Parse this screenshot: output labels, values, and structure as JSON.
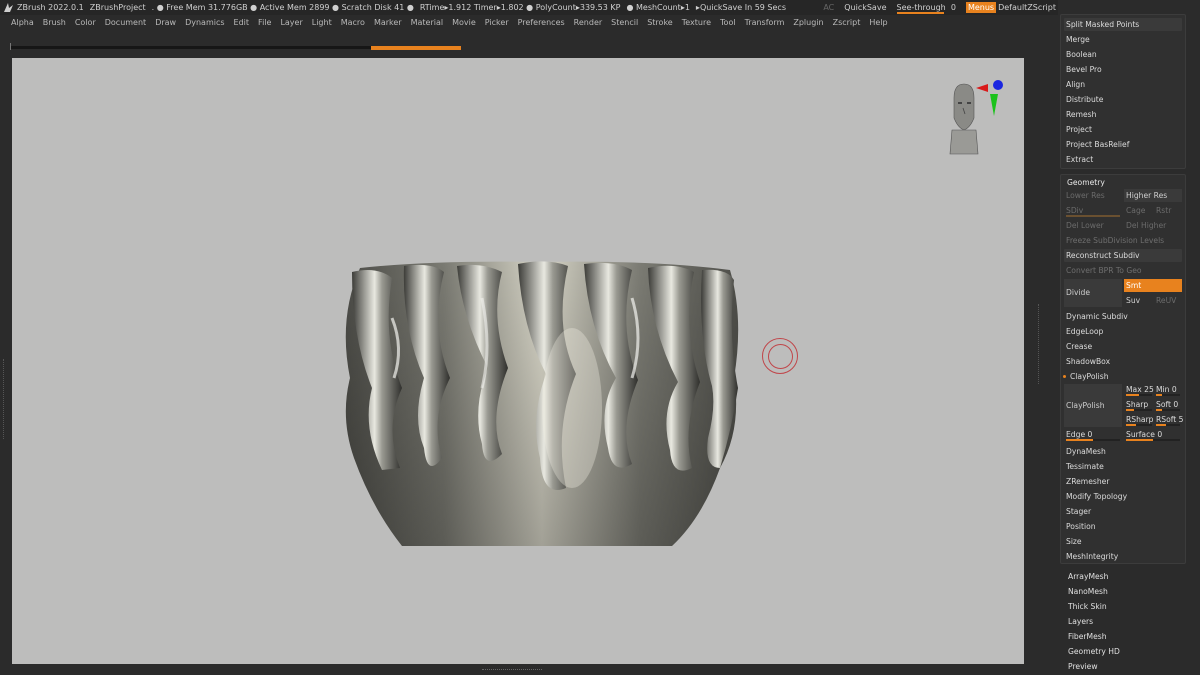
{
  "titlebar": {
    "segments": [
      "ZBrush 2022.0.1",
      "ZBrushProject",
      ". ● Free Mem 31.776GB ● Active Mem 2899 ● Scratch Disk 41 ●",
      "RTime▸1.912 Timer▸1.802 ● PolyCount▸339.53 KP",
      "● MeshCount▸1",
      "▸QuickSave In 59 Secs"
    ],
    "ac": "AC",
    "quicksave": "QuickSave",
    "see_through_label": "See-through",
    "see_through_value": "0",
    "menus": "Menus",
    "default_zscript": "DefaultZScript"
  },
  "menubar": [
    "Alpha",
    "Brush",
    "Color",
    "Document",
    "Draw",
    "Dynamics",
    "Edit",
    "File",
    "Layer",
    "Light",
    "Macro",
    "Marker",
    "Material",
    "Movie",
    "Picker",
    "Preferences",
    "Render",
    "Stencil",
    "Stroke",
    "Texture",
    "Tool",
    "Transform",
    "Zplugin",
    "Zscript",
    "Help"
  ],
  "top_group": [
    "Split Masked Points",
    "Merge",
    "Boolean",
    "Bevel Pro",
    "Align",
    "Distribute",
    "Remesh",
    "Project",
    "Project BasRelief",
    "Extract"
  ],
  "geometry": {
    "header": "Geometry",
    "lower_res": "Lower Res",
    "higher_res": "Higher Res",
    "sdiv": "SDiv",
    "cage": "Cage",
    "rstr": "Rstr",
    "del_lower": "Del Lower",
    "del_higher": "Del Higher",
    "freeze": "Freeze SubDivision Levels",
    "reconstruct": "Reconstruct Subdiv",
    "convert": "Convert BPR To Geo",
    "divide": "Divide",
    "smt": "Smt",
    "suv": "Suv",
    "reuv": "ReUV",
    "dynamic_subdiv": "Dynamic Subdiv",
    "edgeloop": "EdgeLoop",
    "crease": "Crease",
    "shadowbox": "ShadowBox",
    "claypolish_header": "ClayPolish",
    "claypolish_btn": "ClayPolish",
    "max": "Max 25",
    "min": "Min 0",
    "sharp": "Sharp",
    "soft": "Soft 0",
    "rsharp": "RSharp",
    "rsoft": "RSoft 5",
    "edge": "Edge 0",
    "surface": "Surface 0",
    "after": [
      "DynaMesh",
      "Tessimate",
      "ZRemesher",
      "Modify Topology",
      "Stager",
      "Position",
      "Size",
      "MeshIntegrity"
    ]
  },
  "subpalettes": [
    "ArrayMesh",
    "NanoMesh",
    "Thick Skin",
    "Layers",
    "FiberMesh",
    "Geometry HD",
    "Preview"
  ],
  "colors": {
    "accent": "#e8821e",
    "viewport_bg": "#bdbdbc",
    "panel_bg": "#2b2b2b"
  }
}
